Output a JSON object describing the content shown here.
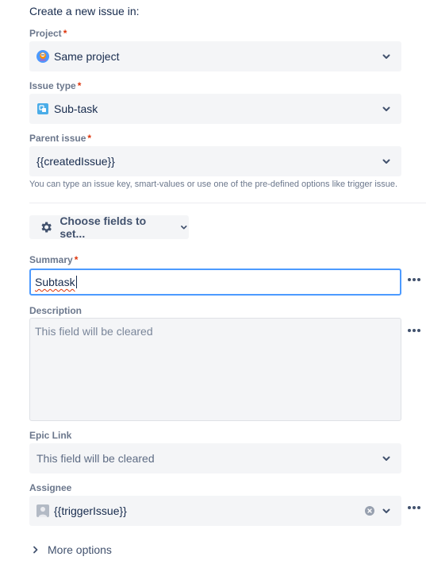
{
  "header": {
    "title": "Create a new issue in:"
  },
  "project": {
    "label": "Project",
    "required": "*",
    "value": "Same project",
    "icon": "project-avatar-icon"
  },
  "issue_type": {
    "label": "Issue type",
    "required": "*",
    "value": "Sub-task",
    "icon": "subtask-icon"
  },
  "parent_issue": {
    "label": "Parent issue",
    "required": "*",
    "value": "{{createdIssue}}",
    "helper": "You can type an issue key, smart-values or use one of the pre-defined options like trigger issue."
  },
  "choose_fields": {
    "label": "Choose fields to set...",
    "icon": "gear-icon"
  },
  "summary": {
    "label": "Summary",
    "required": "*",
    "value": "Subtask"
  },
  "description": {
    "label": "Description",
    "placeholder": "This field will be cleared"
  },
  "epic_link": {
    "label": "Epic Link",
    "placeholder": "This field will be cleared"
  },
  "assignee": {
    "label": "Assignee",
    "value": "{{triggerIssue}}",
    "icon": "user-avatar-icon"
  },
  "more_options": {
    "label": "More options"
  },
  "colors": {
    "accent": "#4c9aff",
    "required": "#de350b",
    "field_bg": "#f4f5f7",
    "label": "#6b778c"
  }
}
